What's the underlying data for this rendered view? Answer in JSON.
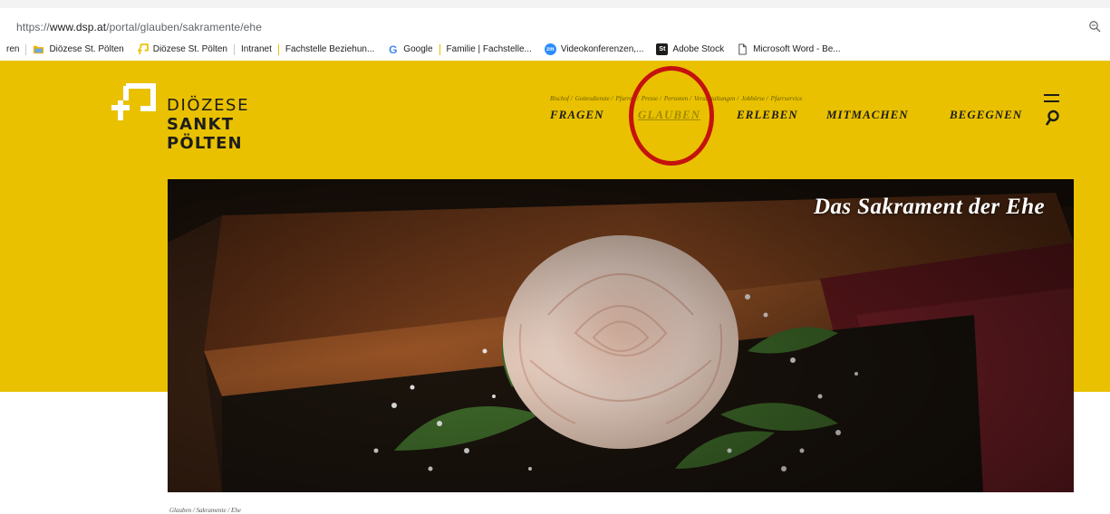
{
  "browser": {
    "url_prefix": "https://",
    "url_host": "www.dsp.at",
    "url_path": "/portal/glauben/sakramente/ehe",
    "bookmarks": [
      {
        "label": "ren",
        "icon": "none"
      },
      {
        "label": "Diözese St. Pölten",
        "icon": "folder-icon"
      },
      {
        "label": "Diözese St. Pölten",
        "icon": "dsp-logo-icon"
      },
      {
        "label": "Intranet",
        "icon": "none"
      },
      {
        "label": "Fachstelle Beziehun...",
        "icon": "none"
      },
      {
        "label": "Google",
        "icon": "google-icon"
      },
      {
        "label": "Familie | Fachstelle...",
        "icon": "none"
      },
      {
        "label": "Videokonferenzen,...",
        "icon": "zoom-icon"
      },
      {
        "label": "Adobe Stock",
        "icon": "adobe-stock-icon"
      },
      {
        "label": "Microsoft Word - Be...",
        "icon": "document-icon"
      }
    ]
  },
  "logo": {
    "line1": "DIÖZESE",
    "line2": "SANKT",
    "line3": "PÖLTEN"
  },
  "subnav": [
    "Bischof /",
    "Gottesdienste /",
    "Pfarren /",
    "Presse /",
    "Personen /",
    "Veranstaltungen /",
    "Jobbörse /",
    "Pfarrservice"
  ],
  "mainnav": [
    "FRAGEN",
    "GLAUBEN",
    "ERLEBEN",
    "MITMACHEN",
    "BEGEGNEN"
  ],
  "mainnav_active": "GLAUBEN",
  "hero": {
    "title": "Das Sakrament der Ehe"
  },
  "breadcrumb": "Glauben / Sakramente / Ehe",
  "colors": {
    "brand_yellow": "#e9c100",
    "annotation_red": "#c4120e",
    "text_dark": "#1d1d1b"
  }
}
